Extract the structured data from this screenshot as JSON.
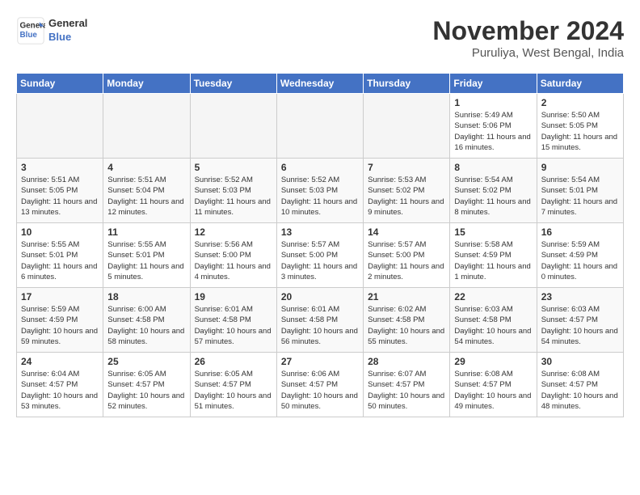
{
  "header": {
    "logo_text_line1": "General",
    "logo_text_line2": "Blue",
    "month_title": "November 2024",
    "location": "Puruliya, West Bengal, India"
  },
  "columns": [
    "Sunday",
    "Monday",
    "Tuesday",
    "Wednesday",
    "Thursday",
    "Friday",
    "Saturday"
  ],
  "weeks": [
    {
      "days": [
        {
          "num": "",
          "info": "",
          "empty": true
        },
        {
          "num": "",
          "info": "",
          "empty": true
        },
        {
          "num": "",
          "info": "",
          "empty": true
        },
        {
          "num": "",
          "info": "",
          "empty": true
        },
        {
          "num": "",
          "info": "",
          "empty": true
        },
        {
          "num": "1",
          "info": "Sunrise: 5:49 AM\nSunset: 5:06 PM\nDaylight: 11 hours\nand 16 minutes.",
          "empty": false
        },
        {
          "num": "2",
          "info": "Sunrise: 5:50 AM\nSunset: 5:05 PM\nDaylight: 11 hours\nand 15 minutes.",
          "empty": false
        }
      ]
    },
    {
      "days": [
        {
          "num": "3",
          "info": "Sunrise: 5:51 AM\nSunset: 5:05 PM\nDaylight: 11 hours\nand 13 minutes.",
          "empty": false
        },
        {
          "num": "4",
          "info": "Sunrise: 5:51 AM\nSunset: 5:04 PM\nDaylight: 11 hours\nand 12 minutes.",
          "empty": false
        },
        {
          "num": "5",
          "info": "Sunrise: 5:52 AM\nSunset: 5:03 PM\nDaylight: 11 hours\nand 11 minutes.",
          "empty": false
        },
        {
          "num": "6",
          "info": "Sunrise: 5:52 AM\nSunset: 5:03 PM\nDaylight: 11 hours\nand 10 minutes.",
          "empty": false
        },
        {
          "num": "7",
          "info": "Sunrise: 5:53 AM\nSunset: 5:02 PM\nDaylight: 11 hours\nand 9 minutes.",
          "empty": false
        },
        {
          "num": "8",
          "info": "Sunrise: 5:54 AM\nSunset: 5:02 PM\nDaylight: 11 hours\nand 8 minutes.",
          "empty": false
        },
        {
          "num": "9",
          "info": "Sunrise: 5:54 AM\nSunset: 5:01 PM\nDaylight: 11 hours\nand 7 minutes.",
          "empty": false
        }
      ]
    },
    {
      "days": [
        {
          "num": "10",
          "info": "Sunrise: 5:55 AM\nSunset: 5:01 PM\nDaylight: 11 hours\nand 6 minutes.",
          "empty": false
        },
        {
          "num": "11",
          "info": "Sunrise: 5:55 AM\nSunset: 5:01 PM\nDaylight: 11 hours\nand 5 minutes.",
          "empty": false
        },
        {
          "num": "12",
          "info": "Sunrise: 5:56 AM\nSunset: 5:00 PM\nDaylight: 11 hours\nand 4 minutes.",
          "empty": false
        },
        {
          "num": "13",
          "info": "Sunrise: 5:57 AM\nSunset: 5:00 PM\nDaylight: 11 hours\nand 3 minutes.",
          "empty": false
        },
        {
          "num": "14",
          "info": "Sunrise: 5:57 AM\nSunset: 5:00 PM\nDaylight: 11 hours\nand 2 minutes.",
          "empty": false
        },
        {
          "num": "15",
          "info": "Sunrise: 5:58 AM\nSunset: 4:59 PM\nDaylight: 11 hours\nand 1 minute.",
          "empty": false
        },
        {
          "num": "16",
          "info": "Sunrise: 5:59 AM\nSunset: 4:59 PM\nDaylight: 11 hours\nand 0 minutes.",
          "empty": false
        }
      ]
    },
    {
      "days": [
        {
          "num": "17",
          "info": "Sunrise: 5:59 AM\nSunset: 4:59 PM\nDaylight: 10 hours\nand 59 minutes.",
          "empty": false
        },
        {
          "num": "18",
          "info": "Sunrise: 6:00 AM\nSunset: 4:58 PM\nDaylight: 10 hours\nand 58 minutes.",
          "empty": false
        },
        {
          "num": "19",
          "info": "Sunrise: 6:01 AM\nSunset: 4:58 PM\nDaylight: 10 hours\nand 57 minutes.",
          "empty": false
        },
        {
          "num": "20",
          "info": "Sunrise: 6:01 AM\nSunset: 4:58 PM\nDaylight: 10 hours\nand 56 minutes.",
          "empty": false
        },
        {
          "num": "21",
          "info": "Sunrise: 6:02 AM\nSunset: 4:58 PM\nDaylight: 10 hours\nand 55 minutes.",
          "empty": false
        },
        {
          "num": "22",
          "info": "Sunrise: 6:03 AM\nSunset: 4:58 PM\nDaylight: 10 hours\nand 54 minutes.",
          "empty": false
        },
        {
          "num": "23",
          "info": "Sunrise: 6:03 AM\nSunset: 4:57 PM\nDaylight: 10 hours\nand 54 minutes.",
          "empty": false
        }
      ]
    },
    {
      "days": [
        {
          "num": "24",
          "info": "Sunrise: 6:04 AM\nSunset: 4:57 PM\nDaylight: 10 hours\nand 53 minutes.",
          "empty": false
        },
        {
          "num": "25",
          "info": "Sunrise: 6:05 AM\nSunset: 4:57 PM\nDaylight: 10 hours\nand 52 minutes.",
          "empty": false
        },
        {
          "num": "26",
          "info": "Sunrise: 6:05 AM\nSunset: 4:57 PM\nDaylight: 10 hours\nand 51 minutes.",
          "empty": false
        },
        {
          "num": "27",
          "info": "Sunrise: 6:06 AM\nSunset: 4:57 PM\nDaylight: 10 hours\nand 50 minutes.",
          "empty": false
        },
        {
          "num": "28",
          "info": "Sunrise: 6:07 AM\nSunset: 4:57 PM\nDaylight: 10 hours\nand 50 minutes.",
          "empty": false
        },
        {
          "num": "29",
          "info": "Sunrise: 6:08 AM\nSunset: 4:57 PM\nDaylight: 10 hours\nand 49 minutes.",
          "empty": false
        },
        {
          "num": "30",
          "info": "Sunrise: 6:08 AM\nSunset: 4:57 PM\nDaylight: 10 hours\nand 48 minutes.",
          "empty": false
        }
      ]
    }
  ]
}
